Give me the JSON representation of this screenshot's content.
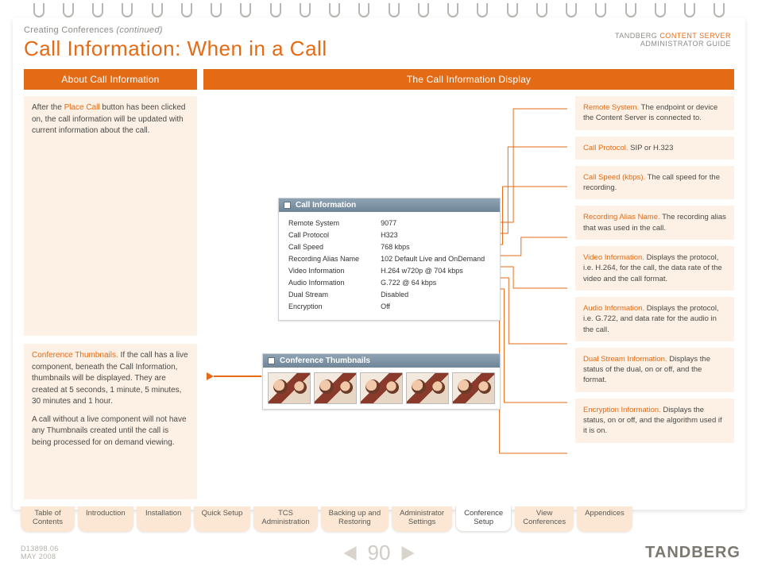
{
  "doc": {
    "vendor": "TANDBERG",
    "product": "CONTENT SERVER",
    "guide": "ADMINISTRATOR GUIDE",
    "id": "D13898.06",
    "date": "MAY 2008",
    "brand": "TANDBERG"
  },
  "pretitle": {
    "main": "Creating Conferences",
    "cont": "(continued)"
  },
  "title": "Call Information: When in a Call",
  "bars": {
    "left": "About Call Information",
    "right": "The Call Information Display"
  },
  "left": {
    "p1_before": "After the ",
    "p1_hl": "Place Call",
    "p1_after": " button has been clicked on, the call information will be updated with current information about the call.",
    "p2_hl": "Conference Thumbnails.",
    "p2_a": " If the call has a live component, beneath the Call Information, thumbnails will be displayed. They are created at 5 seconds, 1 minute, 5 minutes, 30 minutes and 1 hour.",
    "p2_b": "A call without a live component will not have any Thumbnails created until the call is being processed for on demand viewing."
  },
  "callinfo": {
    "head": "Call Information",
    "rows": [
      {
        "label": "Remote System",
        "value": "9077"
      },
      {
        "label": "Call Protocol",
        "value": "H323"
      },
      {
        "label": "Call Speed",
        "value": "768 kbps"
      },
      {
        "label": "Recording Alias Name",
        "value": "102 Default Live and OnDemand"
      },
      {
        "label": "Video Information",
        "value": "H.264 w720p @ 704 kbps"
      },
      {
        "label": "Audio Information",
        "value": "G.722 @ 64 kbps"
      },
      {
        "label": "Dual Stream",
        "value": "Disabled"
      },
      {
        "label": "Encryption",
        "value": "Off"
      }
    ]
  },
  "thumbs": {
    "head": "Conference Thumbnails"
  },
  "right": [
    {
      "hl": "Remote System.",
      "text": " The endpoint or device the Content Server is connected to."
    },
    {
      "hl": "Call Protocol.",
      "text": " SIP or H.323"
    },
    {
      "hl": "Call Speed (kbps).",
      "text": " The call speed for the recording."
    },
    {
      "hl": "Recording Alias Name.",
      "text": " The recording alias that was used in the call."
    },
    {
      "hl": "Video Information.",
      "text": " Displays the protocol, i.e. H.264,  for the call, the data rate of the video and the call format."
    },
    {
      "hl": "Audio Information.",
      "text": " Displays the protocol, i.e. G.722, and data rate for the audio in the call."
    },
    {
      "hl": "Dual Stream Information.",
      "text": " Displays the status of the dual, on or off, and the format."
    },
    {
      "hl": "Encryption Information.",
      "text": " Displays the status, on or off, and the algorithm used if it is on."
    }
  ],
  "tabs": [
    {
      "label": "Table of\nContents",
      "active": false
    },
    {
      "label": "Introduction",
      "active": false
    },
    {
      "label": "Installation",
      "active": false
    },
    {
      "label": "Quick Setup",
      "active": false
    },
    {
      "label": "TCS\nAdministration",
      "active": false
    },
    {
      "label": "Backing up and\nRestoring",
      "active": false
    },
    {
      "label": "Administrator\nSettings",
      "active": false
    },
    {
      "label": "Conference\nSetup",
      "active": true
    },
    {
      "label": "View\nConferences",
      "active": false
    },
    {
      "label": "Appendices",
      "active": false
    }
  ],
  "page_number": "90"
}
